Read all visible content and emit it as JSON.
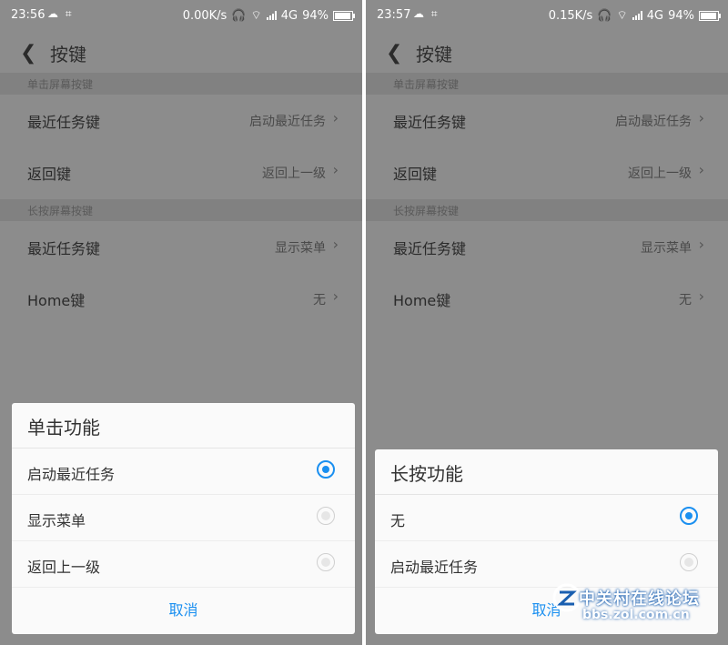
{
  "left": {
    "status": {
      "time": "23:56",
      "speed": "0.00K/s",
      "network": "4G",
      "battery": "94%",
      "battery_level": 0.94
    },
    "title": "按键",
    "sections": [
      {
        "header": "单击屏幕按键",
        "rows": [
          {
            "label": "最近任务键",
            "value": "启动最近任务"
          },
          {
            "label": "返回键",
            "value": "返回上一级"
          }
        ]
      },
      {
        "header": "长按屏幕按键",
        "rows": [
          {
            "label": "最近任务键",
            "value": "显示菜单"
          },
          {
            "label": "Home键",
            "value": "无"
          }
        ]
      }
    ],
    "dialog": {
      "title": "单击功能",
      "options": [
        {
          "label": "启动最近任务",
          "selected": true
        },
        {
          "label": "显示菜单",
          "selected": false
        },
        {
          "label": "返回上一级",
          "selected": false
        }
      ],
      "cancel": "取消"
    }
  },
  "right": {
    "status": {
      "time": "23:57",
      "speed": "0.15K/s",
      "network": "4G",
      "battery": "94%",
      "battery_level": 0.94
    },
    "title": "按键",
    "sections": [
      {
        "header": "单击屏幕按键",
        "rows": [
          {
            "label": "最近任务键",
            "value": "启动最近任务"
          },
          {
            "label": "返回键",
            "value": "返回上一级"
          }
        ]
      },
      {
        "header": "长按屏幕按键",
        "rows": [
          {
            "label": "最近任务键",
            "value": "显示菜单"
          },
          {
            "label": "Home键",
            "value": "无"
          }
        ]
      }
    ],
    "dialog": {
      "title": "长按功能",
      "options": [
        {
          "label": "无",
          "selected": true
        },
        {
          "label": "启动最近任务",
          "selected": false
        }
      ],
      "cancel": "取消"
    }
  },
  "watermark": {
    "name": "中关村在线论坛",
    "url": "bbs.zol.com.cn"
  },
  "colors": {
    "accent": "#1a8ff0",
    "overlay": "#8c8c8c",
    "dialog_bg": "#fafafa"
  },
  "icons": {
    "back": "chevron-left-icon",
    "chevron": "chevron-right-icon",
    "wifi": "wifi-icon",
    "headphones": "headphones-icon"
  }
}
